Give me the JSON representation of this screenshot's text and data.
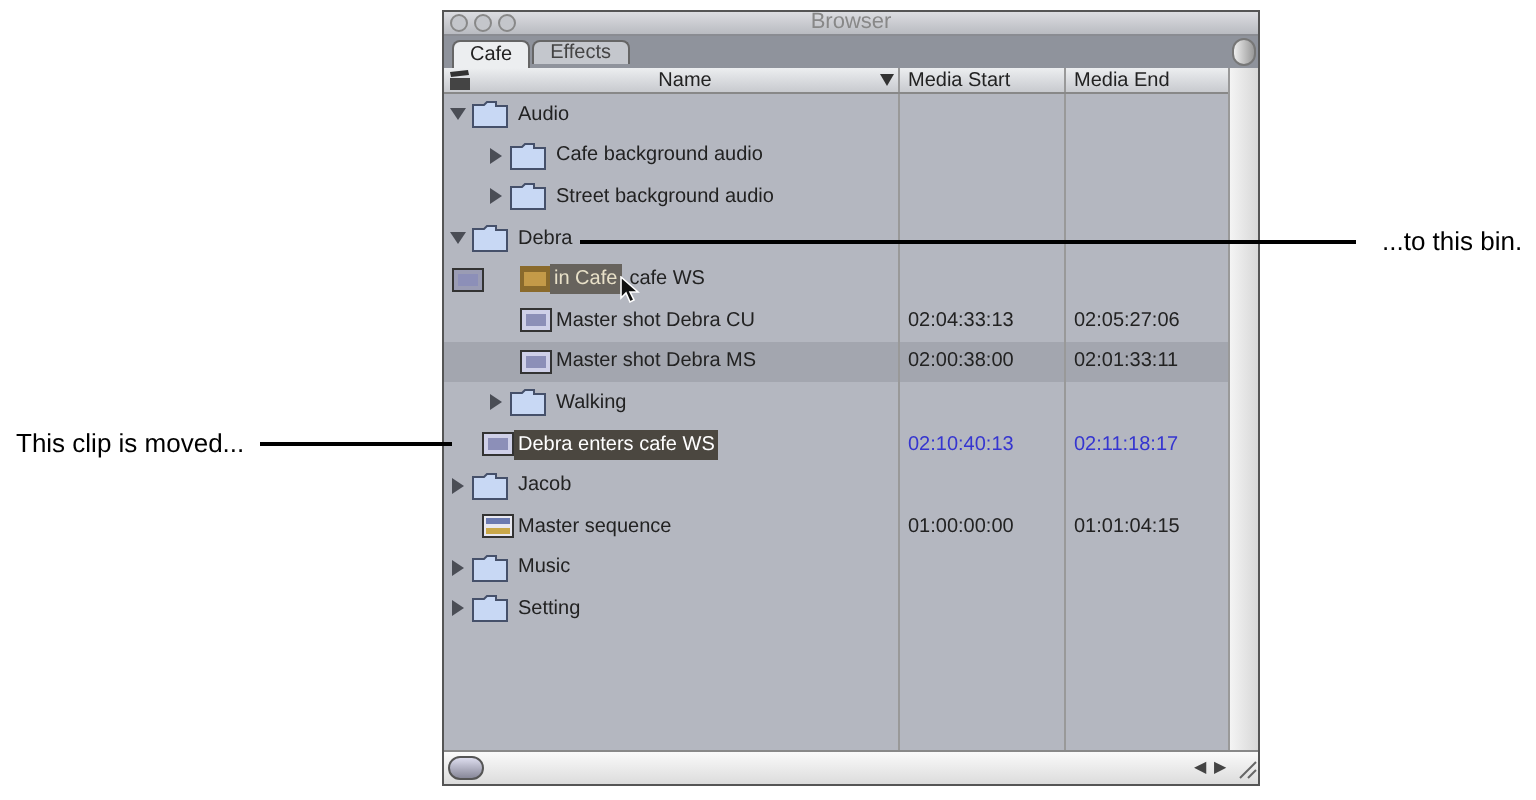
{
  "window": {
    "title": "Browser"
  },
  "tabs": [
    {
      "label": "Cafe",
      "selected": true
    },
    {
      "label": "Effects",
      "selected": false
    }
  ],
  "columns": [
    "Name",
    "Media Start",
    "Media End"
  ],
  "rows": [
    {
      "kind": "folder",
      "name": "Audio",
      "expanded": true,
      "selected": false,
      "dragged": false,
      "children": [
        {
          "kind": "folder",
          "name": "Cafe background audio",
          "expanded": false,
          "selected": false,
          "dragged": false
        },
        {
          "kind": "folder",
          "name": "Street background audio",
          "expanded": false,
          "selected": false,
          "dragged": false
        }
      ]
    },
    {
      "kind": "folder",
      "name": "Debra",
      "expanded": true,
      "selected": false,
      "dragged": false,
      "children": [
        {
          "kind": "drag",
          "ghost_label": "in Cafe",
          "name": "cafe WS",
          "selected": false,
          "dragged": true
        },
        {
          "kind": "clip",
          "name": "Master shot Debra CU",
          "media_start": "02:04:33:13",
          "media_end": "02:05:27:06",
          "selected": false,
          "dragged": false
        },
        {
          "kind": "clip",
          "name": "Master shot Debra MS",
          "media_start": "02:00:38:00",
          "media_end": "02:01:33:11",
          "selected": true,
          "dragged": false
        },
        {
          "kind": "folder",
          "name": "Walking",
          "expanded": false,
          "selected": false,
          "dragged": false
        }
      ]
    },
    {
      "kind": "clip",
      "name": "Debra enters cafe WS",
      "media_start": "02:10:40:13",
      "media_end": "02:11:18:17",
      "selected": false,
      "dragged": true
    },
    {
      "kind": "folder",
      "name": "Jacob",
      "expanded": false,
      "selected": false,
      "dragged": false
    },
    {
      "kind": "sequence",
      "name": "Master sequence",
      "media_start": "01:00:00:00",
      "media_end": "01:01:04:15",
      "selected": false,
      "dragged": false
    },
    {
      "kind": "folder",
      "name": "Music",
      "expanded": false,
      "selected": false,
      "dragged": false
    },
    {
      "kind": "folder",
      "name": "Setting",
      "expanded": false,
      "selected": false,
      "dragged": false
    }
  ],
  "scroll_arrows": [
    "◀",
    "▶"
  ],
  "callouts": [
    {
      "kind": "right",
      "text": "...to this bin."
    },
    {
      "kind": "left",
      "text": "This clip is moved..."
    }
  ]
}
